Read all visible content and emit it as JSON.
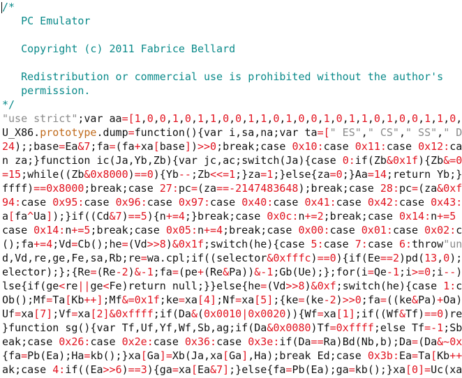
{
  "colors": {
    "comment": "#0a8a8a",
    "text": "#111111",
    "red": "#e1131f",
    "string": "#8a8a8a",
    "prototype": "#c06a1b",
    "background": "#ffffff"
  },
  "editor": {
    "comment_lines": [
      "/*",
      "   PC Emulator",
      "",
      "   Copyright (c) 2011 Fabrice Bellard",
      "",
      "   Redistribution or commercial use is prohibited without the author's",
      "   permission.",
      "*/"
    ],
    "code_lines": [
      "\"use strict\";var aa=[1,0,0,1,0,1,1,0,0,1,1,0,1,0,0,1,0,1,1,0,1,0,0,1,1,0,0,1,",
      "U_X86.prototype.dump=function(){var i,sa,na;var ta=[\" ES\",\" CS\",\" SS\",\" DS\"",
      "24);;base=Ea&7;fa=(fa+xa[base])>>0;break;case 0x10:case 0x11:case 0x12:cas",
      "n za;}function ic(Ja,Yb,Zb){var jc,ac;switch(Ja){case 0:if(Zb&0x1f){Zb&=0x",
      "=15;while((Zb&0x8000)==0){Yb--;Zb<<=1;}za=1;}else{za=0;}Aa=14;return Yb;}",
      "ffff)==0x8000;break;case 27:pc=(za==-2147483648);break;case 28:pc=(za&0xf",
      "94:case 0x95:case 0x96:case 0x97:case 0x40:case 0x41:case 0x42:case 0x43:c",
      "a[fa^Ua]);}if((Cd&7)==5){n+=4;}break;case 0x0c:n+=2;break;case 0x14:n+=5",
      "case 0x14:n+=5;break;case 0x05:n+=4;break;case 0x00:case 0x01:case 0x02:ca",
      "();fa+=4;Vd=Cb();he=(Vd>>8)&0x1f;switch(he){case 5:case 7:case 6:throw\"uns",
      "d,Vd,re,ge,Fe,sa,Rb;re=wa.cpl;if((selector&0xfffc)==0){if(Ee==2)pd(13,0);e",
      "elector);};{Re=(Re-2)&-1;fa=(pe+(Re&Pa))&-1;Gb(Ue);};for(i=Qe-1;i>=0;i--)",
      "lse{if(ge<re||ge<Fe)return null;}}else{he=(Vd>>8)&0xf;switch(he){case 1:ca",
      "Ob();Mf=Ta[Kb++];Mf&=0x1f;ke=xa[4];Nf=xa[5];{ke=(ke-2)>>0;fa=((ke&Pa)+Oa)",
      "Uf=xa[7];Vf=xa[2]&0xffff;if(Da&(0x0010|0x0020)){Wf=xa[1];if((Wf&Tf)==0)re",
      "}function sg(){var Tf,Uf,Yf,Wf,Sb,ag;if(Da&0x0080)Tf=0xffff;else Tf=-1;Sb=",
      "eak;case 0x26:case 0x2e:case 0x36:case 0x3e:if(Da==Ra)Bd(Nb,b);Da=(Da&~0x0",
      "{fa=Pb(Ea);Ha=kb();}xa[Ga]=Xb(Ja,xa[Ga],Ha);break Ed;case 0x3b:Ea=Ta[Kb++]",
      "ak;case 4:if((Ea>>6)==3){ga=xa[Ea&7];}else{fa=Pb(Ea);ga=kb();}xa[0]=Uc(xa["
    ]
  }
}
